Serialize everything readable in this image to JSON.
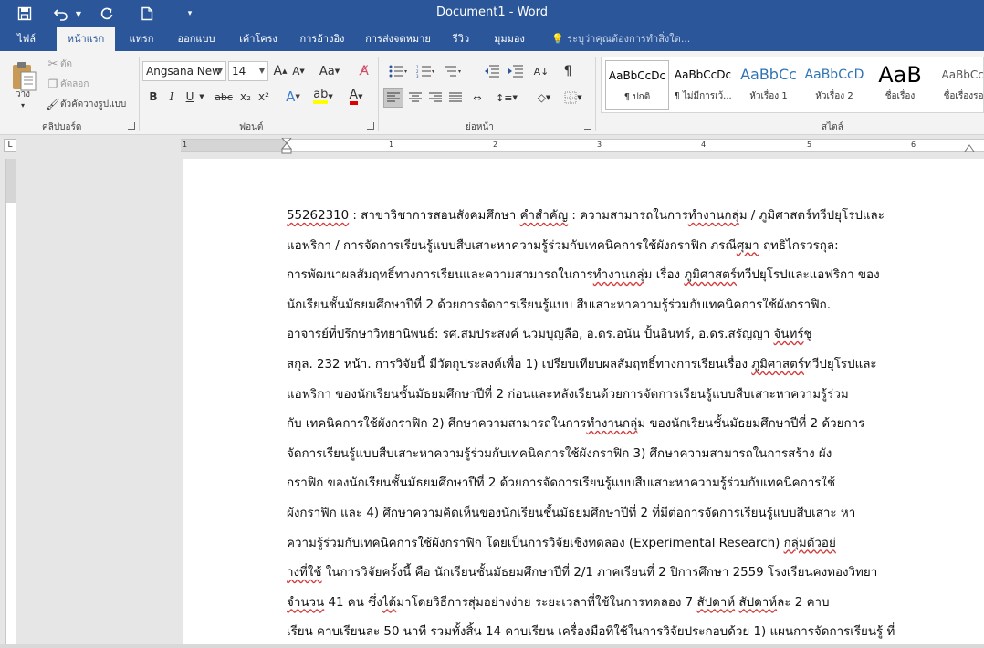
{
  "window": {
    "title": "Document1 - Word"
  },
  "quick_access": {
    "save_icon": "save-icon",
    "undo_icon": "undo-icon",
    "redo_icon": "redo-icon",
    "new_icon": "new-document-icon",
    "customize_icon": "customize-quick-access-icon"
  },
  "tabs": [
    {
      "label": "ไฟล์"
    },
    {
      "label": "หน้าแรก"
    },
    {
      "label": "แทรก"
    },
    {
      "label": "ออกแบบ"
    },
    {
      "label": "เค้าโครง"
    },
    {
      "label": "การอ้างอิง"
    },
    {
      "label": "การส่งจดหมาย"
    },
    {
      "label": "รีวิว"
    },
    {
      "label": "มุมมอง"
    }
  ],
  "tell_me": {
    "placeholder": "ระบุว่าคุณต้องการทำสิ่งใด..."
  },
  "clipboard": {
    "group_label": "คลิปบอร์ด",
    "paste_label": "วาง",
    "cut_label": "ตัด",
    "copy_label": "คัดลอก",
    "format_painter_label": "ตัวคัดวางรูปแบบ"
  },
  "font": {
    "group_label": "ฟอนต์",
    "font_name": "Angsana New",
    "font_size": "14",
    "bold": "B",
    "italic": "I",
    "underline": "U",
    "strike": "abc",
    "subscript": "x₂",
    "superscript": "x²",
    "grow": "A",
    "shrink": "A",
    "change_case": "Aa",
    "highlight_color": "#ffff00",
    "font_color": "#e00000"
  },
  "paragraph": {
    "group_label": "ย่อหน้า"
  },
  "styles": {
    "group_label": "สไตล์",
    "items": [
      {
        "preview": "AaBbCcDc",
        "name": "¶ ปกติ"
      },
      {
        "preview": "AaBbCcDc",
        "name": "¶ ไม่มีการเว้..."
      },
      {
        "preview": "AaBbCc",
        "name": "หัวเรื่อง 1"
      },
      {
        "preview": "AaBbCcD",
        "name": "หัวเรื่อง 2"
      },
      {
        "preview": "AaB",
        "name": "ชื่อเรื่อง"
      },
      {
        "preview": "AaBbCcc",
        "name": "ชื่อเรื่องรอง"
      }
    ]
  },
  "ruler": {
    "numbers": [
      "1",
      "1",
      "2",
      "3",
      "4",
      "5",
      "6"
    ]
  },
  "document": {
    "lines": [
      [
        {
          "t": "55262310",
          "sq": true
        },
        {
          "t": " : สาขาวิชาการสอนสังคมศึกษา "
        },
        {
          "t": "คำสำคัญ",
          "sq": true
        },
        {
          "t": " : ความสามารถในการ"
        },
        {
          "t": "ทำงานกลุ",
          "sq": true
        },
        {
          "t": "่ม / ภูมิศาสตร"
        },
        {
          "t": "์ทวีปยุโรปและ"
        }
      ],
      [
        {
          "t": "แอฟริกา / การจัดการเรียนรู้แบบสืบเสาะหาความรู้ร่วมกับเทคนิคการใช้ผังกราฟิก ภรณ"
        },
        {
          "t": "ีศุมา",
          "sq": true
        },
        {
          "t": " ฤทธิไกรวรกุล:"
        }
      ],
      [
        {
          "t": "การพัฒนาผลสัมฤทธิ์ทางการเรียนและความสามารถในการ"
        },
        {
          "t": "ทำงานกลุ",
          "sq": true
        },
        {
          "t": "่ม เรื่อง "
        },
        {
          "t": "ภูมิศาสตร",
          "sq": true
        },
        {
          "t": "์ทวีปยุโรปและแอฟริกา ของ"
        }
      ],
      [
        {
          "t": "นักเรียนชั้นมัธยมศึกษาปีที่ 2 ด้วยการจัดการเรียนรู้แบบ สืบเสาะหาความรู้ร่วมกับเทคนิคการใช้ผังกราฟิก."
        }
      ],
      [
        {
          "t": "อาจารย์ที่ปรึกษาวิทยานิพนธ์: รศ.สมประสงค์ น่วมบุญลือ, อ.ดร.อนัน ปั้นอินทร์, อ.ดร.สรัญญา "
        },
        {
          "t": "จันทร",
          "sq": true
        },
        {
          "t": "์ชู"
        }
      ],
      [
        {
          "t": "สกุล. 232 หน้า. การวิจัยนี้ มีวัตถุประสงค์เพื่อ 1) เปรียบเทียบผลสัมฤทธิ์ทางการเรียนเรื่อง "
        },
        {
          "t": "ภูมิศาสตร",
          "sq": true
        },
        {
          "t": "์ทวีปยุโรปและ"
        }
      ],
      [
        {
          "t": "แอฟริกา ของนักเรียนชั้นมัธยมศึกษาปีที่ 2 ก่อนและหลังเรียนด้วยการจัดการเรียนรู้แบบสืบเสาะหาความรู้ร่วม"
        }
      ],
      [
        {
          "t": "กับ เทคนิคการใช้ผังกราฟิก 2) ศึกษาความสามารถในการ"
        },
        {
          "t": "ทำงานกลุ",
          "sq": true
        },
        {
          "t": "่ม ของนักเรียนชั้นมัธยมศึกษาปีที่ 2 ด้วยการ"
        }
      ],
      [
        {
          "t": "จัดการเรียนรู้แบบสืบเสาะหาความรู้ร่วมกับเทคนิคการใช้ผังกราฟิก 3) ศึกษาความสามารถในการสร้าง ผัง"
        }
      ],
      [
        {
          "t": "กราฟิก ของนักเรียนชั้นมัธยมศึกษาปีที่ 2 ด้วยการจัดการเรียนรู้แบบสืบเสาะหาความรู้ร่วมกับเทคนิคการใช้"
        }
      ],
      [
        {
          "t": "ผังกราฟิก และ 4) ศึกษาความคิดเห็นของนักเรียนชั้นมัธยมศึกษาปีที่ 2 ที่มีต่อการจัดการเรียนรู้แบบสืบเสาะ หา"
        }
      ],
      [
        {
          "t": "ความรู้ร่วมกับเทคนิคการใช้ผังกราฟิก โดยเป็นการวิจัยเชิงทดลอง (Experimental Research) "
        },
        {
          "t": "กลุ่มตัวอย",
          "sq": true
        },
        {
          "t": "่"
        }
      ],
      [
        {
          "t": "างที่ใช้",
          "sq": true
        },
        {
          "t": " ในการวิจัยครั้งนี้ คือ นักเรียนชั้นมัธยมศึกษาปีที่ 2/1 ภาคเรียนที่ 2 ปีการศึกษา 2559 โรงเรียนคงทองวิทยา"
        }
      ],
      [
        {
          "t": "จำนวน",
          "sq": true
        },
        {
          "t": " 41 คน ซึ่ง"
        },
        {
          "t": "ได้",
          "sq": true
        },
        {
          "t": "มาโดยวิธีการสุ่มอย่างง่าย ระยะเวลาที่ใช้ในการทดลอง 7 "
        },
        {
          "t": "สัปดาห",
          "sq": true
        },
        {
          "t": "์ "
        },
        {
          "t": "สัปดาห",
          "sq": true
        },
        {
          "t": "์ละ 2 คาบ"
        }
      ],
      [
        {
          "t": "เรียน คาบเรียนละ 50 นาที รวมทั้งสิ้น 14 คาบเรียน เครื่องมือที่ใช้ในการวิจัยประกอบด้วย 1) แผนการจัดการเรียนรู้ ที่"
        }
      ]
    ]
  }
}
